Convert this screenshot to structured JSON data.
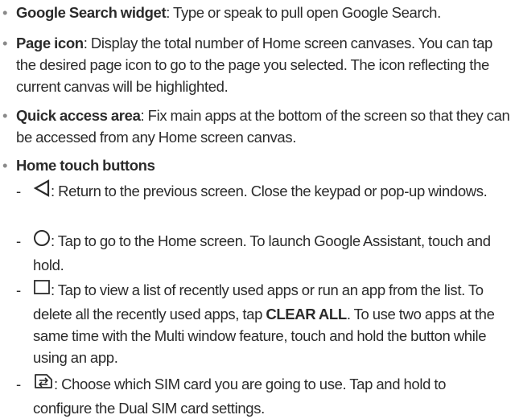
{
  "bullets": [
    {
      "bullet": "•",
      "term": "Google Search widget",
      "text": ": Type or speak to pull open Google Search."
    },
    {
      "bullet": "•",
      "term": "Page icon",
      "text": ": Display the total number of Home screen canvases. You can tap the desired page icon to go to the page you selected. The icon reflecting the current canvas will be highlighted."
    },
    {
      "bullet": "•",
      "term": "Quick access area",
      "text": ": Fix main apps at the bottom of the screen so that they can be accessed from any Home screen canvas."
    },
    {
      "bullet": "•",
      "term": "Home touch buttons",
      "text": ""
    }
  ],
  "touch_buttons": [
    {
      "dash": "-",
      "icon": "back-icon",
      "text": ": Return to the previous screen. Close the keypad or pop-up windows."
    },
    {
      "dash": "-",
      "icon": "home-icon",
      "text": ": Tap to go to the Home screen. To launch Google Assistant, touch and hold."
    },
    {
      "dash": "-",
      "icon": "recent-apps-icon",
      "text_before": ": Tap to view a list of recently used apps or run an app from the list. To delete all the recently used apps, tap ",
      "bold": "CLEAR ALL",
      "text_after": ". To use two apps at the same time with the Multi window feature, touch and hold the button while using an app."
    },
    {
      "dash": "-",
      "icon": "sim-switch-icon",
      "text": ": Choose which SIM card you are going to use. Tap and hold to configure the Dual SIM card settings."
    }
  ]
}
